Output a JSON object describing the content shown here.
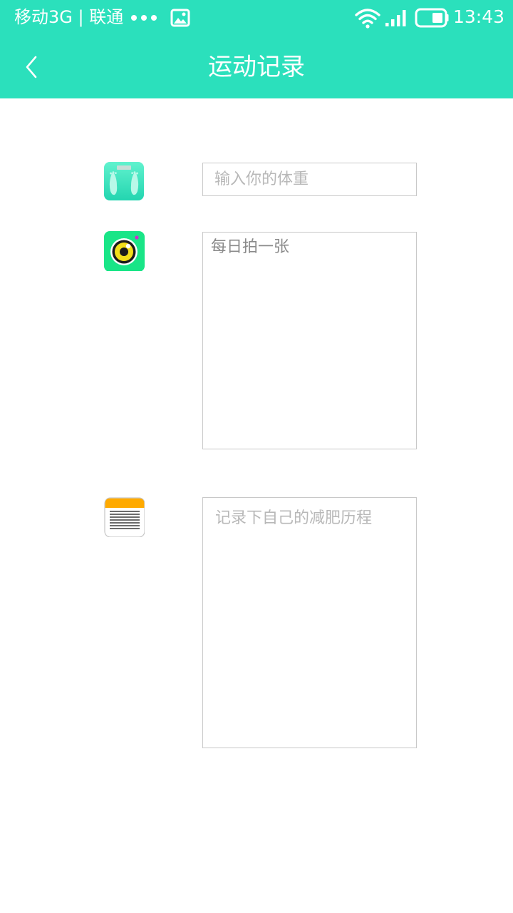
{
  "status_bar": {
    "carrier": "移动3G | 联通",
    "time": "13:43",
    "icons": [
      "more-dots-icon",
      "image-icon",
      "wifi-icon",
      "signal-icon",
      "battery-icon"
    ]
  },
  "header": {
    "title": "运动记录",
    "back_icon": "chevron-left-icon"
  },
  "form": {
    "weight": {
      "icon": "bathroom-scale-icon",
      "placeholder": "输入你的体重",
      "value": ""
    },
    "photo": {
      "icon": "camera-icon",
      "label": "每日拍一张"
    },
    "diary": {
      "icon": "notes-icon",
      "placeholder": "记录下自己的减肥历程",
      "value": ""
    }
  },
  "colors": {
    "accent": "#2be0bc",
    "border": "#c8c8c8",
    "placeholder": "#b8b8b8",
    "label": "#8a8a8a",
    "notes_top": "#ffaa00"
  }
}
